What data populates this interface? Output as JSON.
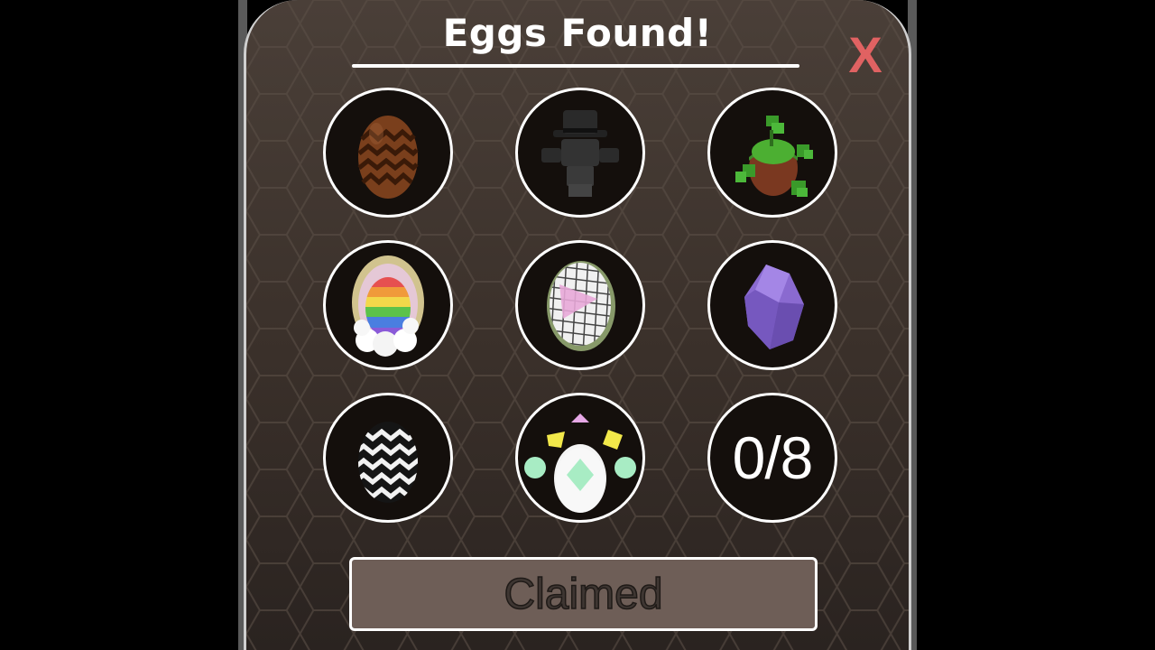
{
  "dialog": {
    "title": "Eggs Found!",
    "close_label": "X",
    "progress_text": "0/8",
    "progress": {
      "found": 0,
      "total": 8
    },
    "claim_button_label": "Claimed"
  },
  "slots": [
    {
      "icon": "brown-chevron-egg-icon"
    },
    {
      "icon": "top-hat-figure-icon"
    },
    {
      "icon": "leafy-egg-icon"
    },
    {
      "icon": "rainbow-cloud-egg-icon"
    },
    {
      "icon": "grid-pattern-egg-icon"
    },
    {
      "icon": "purple-crystal-egg-icon"
    },
    {
      "icon": "black-white-zigzag-egg-icon"
    },
    {
      "icon": "pastel-gem-egg-icon"
    }
  ],
  "colors": {
    "panel_bg": "#4a3f38",
    "close_x": "#e06262",
    "claimed_button_bg": "#6e5e57",
    "title_text": "#ffffff"
  }
}
